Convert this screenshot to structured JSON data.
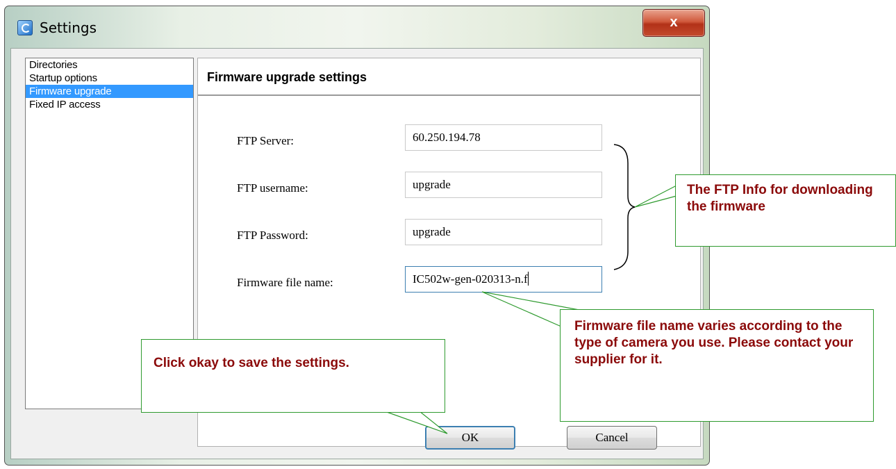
{
  "window": {
    "title": "Settings",
    "close_label": "x"
  },
  "sidebar": {
    "items": [
      {
        "label": "Directories"
      },
      {
        "label": "Startup options"
      },
      {
        "label": "Firmware upgrade"
      },
      {
        "label": "Fixed IP access"
      }
    ],
    "selected": "Firmware upgrade"
  },
  "panel": {
    "title": "Firmware upgrade settings",
    "fields": [
      {
        "label": "FTP Server:",
        "value": "60.250.194.78"
      },
      {
        "label": "FTP username:",
        "value": "upgrade"
      },
      {
        "label": "FTP Password:",
        "value": "upgrade"
      },
      {
        "label": "Firmware file name:",
        "value": "IC502w-gen-020313-n.f"
      }
    ]
  },
  "buttons": {
    "ok": "OK",
    "cancel": "Cancel"
  },
  "callouts": {
    "ftp_info": "The FTP Info for downloading the firmware",
    "firmware_name": "Firmware file name varies according to the type of camera you use. Please contact your supplier for it.",
    "ok_hint": "Click okay to save the settings."
  },
  "colors": {
    "selection": "#3399ff",
    "callout_text": "#8b0a0a",
    "callout_border": "#2e9a2e",
    "close_button": "#c34a2d"
  }
}
